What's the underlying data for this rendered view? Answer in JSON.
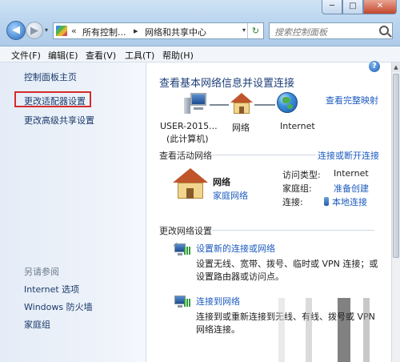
{
  "window": {
    "controls": {
      "minimize": "─",
      "maximize": "□",
      "close": "✕"
    }
  },
  "navigation": {
    "back": "◀",
    "forward": "▶",
    "dropdown": "▾",
    "address": {
      "chevron": "«",
      "segments": [
        "所有控制...",
        "网络和共享中心"
      ],
      "separator": "▸",
      "dropdown": "▾",
      "refresh": "↻"
    },
    "search": {
      "placeholder": "搜索控制面板"
    }
  },
  "menu": [
    "文件(F)",
    "编辑(E)",
    "查看(V)",
    "工具(T)",
    "帮助(H)"
  ],
  "sidebar": {
    "items": [
      "控制面板主页",
      "更改适配器设置",
      "更改高级共享设置"
    ],
    "see_also_label": "另请参阅",
    "see_also": [
      "Internet 选项",
      "Windows 防火墙",
      "家庭组"
    ]
  },
  "main": {
    "help": "?",
    "heading": "查看基本网络信息并设置连接",
    "view_full_map": "查看完整映射",
    "map": {
      "computer_name": "USER-2015...",
      "computer_sub": "(此计算机)",
      "network": "网络",
      "internet": "Internet"
    },
    "active_networks": {
      "title": "查看活动网络",
      "connect_disconnect": "连接或断开连接",
      "network_name": "网络",
      "network_type": "家庭网络",
      "access_type_label": "访问类型:",
      "access_type_value": "Internet",
      "homegroup_label": "家庭组:",
      "homegroup_value": "准备创建",
      "connections_label": "连接:",
      "connections_value": "本地连接"
    },
    "change_settings": {
      "title": "更改网络设置",
      "tasks": [
        {
          "title": "设置新的连接或网络",
          "desc_line1": "设置无线、宽带、拨号、临时或 VPN 连接；或",
          "desc_line2": "设置路由器或访问点。"
        },
        {
          "title": "连接到网络",
          "desc_line1": "连接到或重新连接到无线、有线、拨号或 VPN",
          "desc_line2": "网络连接。"
        }
      ]
    }
  },
  "colors": {
    "link": "#1d5bbf",
    "heading": "#1c3f7a",
    "highlight_box": "#d62b2b"
  }
}
